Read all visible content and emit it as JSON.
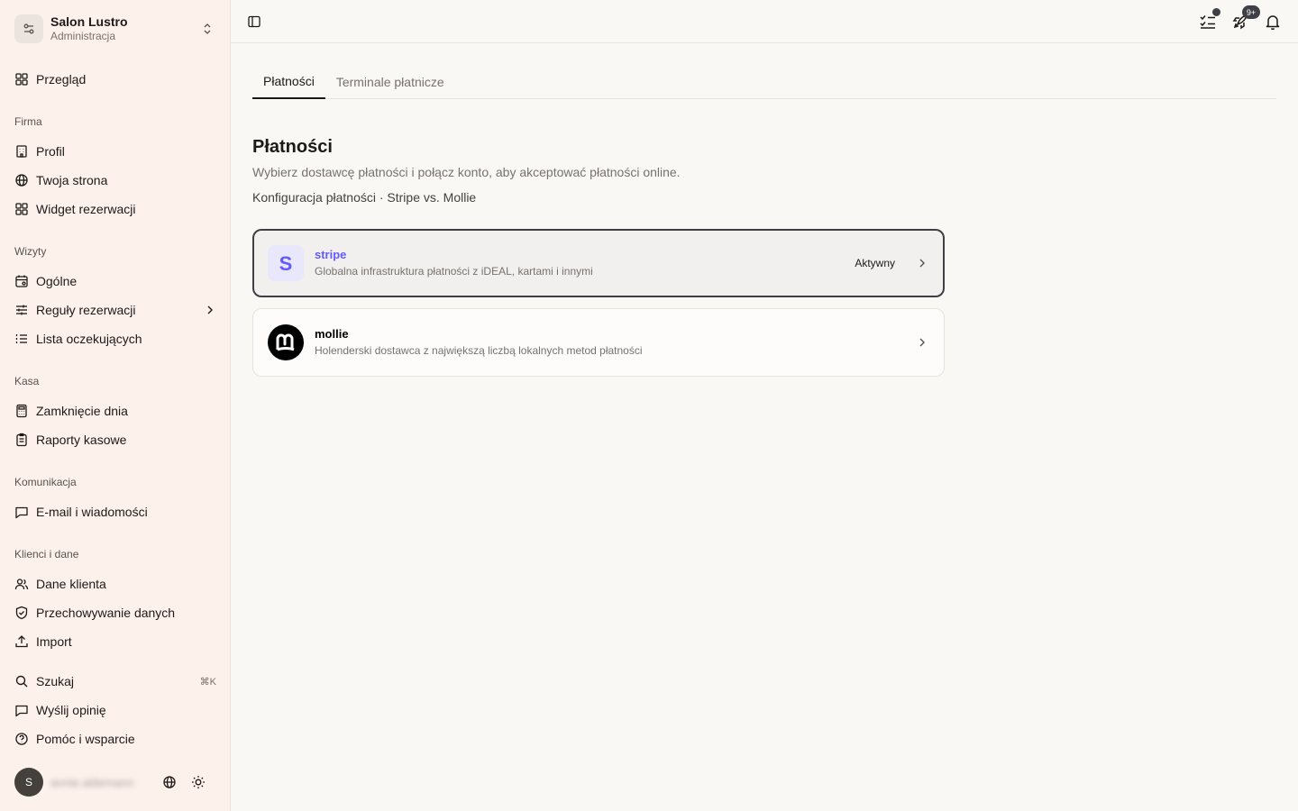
{
  "org": {
    "name": "Salon Lustro",
    "subtitle": "Administracja"
  },
  "sidebar": {
    "overview": "Przegląd",
    "sections": {
      "firma": "Firma",
      "wizyty": "Wizyty",
      "kasa": "Kasa",
      "komunikacja": "Komunikacja",
      "klienci": "Klienci i dane"
    },
    "items": {
      "profil": "Profil",
      "strona": "Twoja strona",
      "widget": "Widget rezerwacji",
      "ogolne": "Ogólne",
      "reguly": "Reguły rezerwacji",
      "lista": "Lista oczekujących",
      "zamkniecie": "Zamknięcie dnia",
      "raporty": "Raporty kasowe",
      "email": "E-mail i wiadomości",
      "dane": "Dane klienta",
      "przechowywanie": "Przechowywanie danych",
      "import": "Import"
    },
    "footer": {
      "search": "Szukaj",
      "search_shortcut": "⌘K",
      "feedback": "Wyślij opinię",
      "help": "Pomóc i wsparcie"
    },
    "user": {
      "initial": "S",
      "name": "annie.aldemann"
    }
  },
  "topbar": {
    "badge": "9+"
  },
  "tabs": [
    "Płatności",
    "Terminale płatnicze"
  ],
  "page": {
    "title": "Płatności",
    "description": "Wybierz dostawcę płatności i połącz konto, aby akceptować płatności online.",
    "link": "Konfiguracja płatności · Stripe vs. Mollie"
  },
  "providers": [
    {
      "name": "stripe",
      "description": "Globalna infrastruktura płatności z iDEAL, kartami i innymi",
      "status": "Aktywny",
      "brand_color": "#635bff"
    },
    {
      "name": "mollie",
      "description": "Holenderski dostawca z największą liczbą lokalnych metod płatności",
      "status": "",
      "brand_color": "#000000"
    }
  ]
}
